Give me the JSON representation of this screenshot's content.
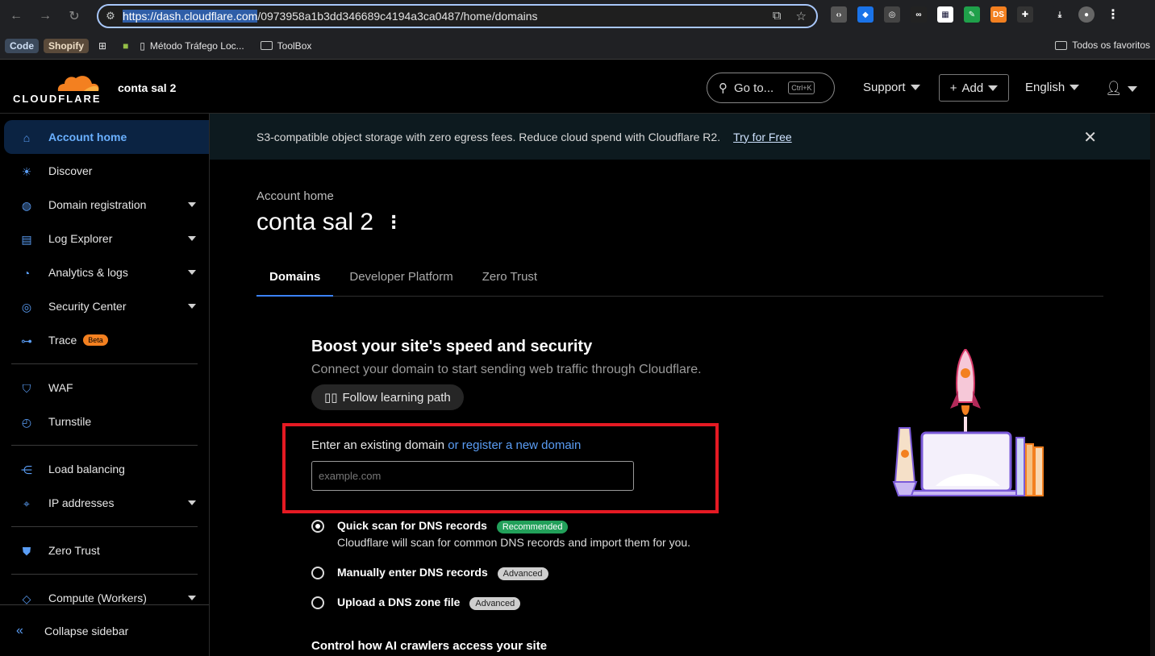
{
  "browser": {
    "url_selected": "https://dash.cloudflare.com",
    "url_rest": "/0973958a1b3dd346689c4194a3ca0487/home/domains",
    "bookmarks": {
      "code": "Code",
      "shopify": "Shopify",
      "metodo": "Método Tráfego Loc...",
      "toolbox": "ToolBox",
      "all": "Todos os favoritos"
    }
  },
  "header": {
    "logo_text": "CLOUDFLARE",
    "account": "conta sal 2",
    "goto": "Go to...",
    "goto_kbd": "Ctrl+K",
    "support": "Support",
    "add": "Add",
    "language": "English"
  },
  "sidebar": {
    "items": [
      {
        "label": "Account home",
        "icon": "home-icon"
      },
      {
        "label": "Discover",
        "icon": "lightbulb-icon"
      },
      {
        "label": "Domain registration",
        "icon": "globe-icon"
      },
      {
        "label": "Log Explorer",
        "icon": "document-icon"
      },
      {
        "label": "Analytics & logs",
        "icon": "pie-chart-icon"
      },
      {
        "label": "Security Center",
        "icon": "target-icon"
      },
      {
        "label": "Trace",
        "icon": "trace-icon",
        "badge": "Beta"
      },
      {
        "label": "WAF",
        "icon": "shield-icon"
      },
      {
        "label": "Turnstile",
        "icon": "turnstile-icon"
      },
      {
        "label": "Load balancing",
        "icon": "network-icon"
      },
      {
        "label": "IP addresses",
        "icon": "location-icon"
      },
      {
        "label": "Zero Trust",
        "icon": "zero-trust-icon"
      },
      {
        "label": "Compute (Workers)",
        "icon": "workers-icon"
      }
    ],
    "collapse": "Collapse sidebar"
  },
  "banner": {
    "text": "S3-compatible object storage with zero egress fees. Reduce cloud spend with Cloudflare R2.",
    "link": "Try for Free"
  },
  "page": {
    "breadcrumb": "Account home",
    "title": "conta sal 2",
    "tabs": [
      "Domains",
      "Developer Platform",
      "Zero Trust"
    ]
  },
  "onboarding": {
    "heading": "Boost your site's speed and security",
    "subheading": "Connect your domain to start sending web traffic through Cloudflare.",
    "learn_button": "Follow learning path",
    "domain_label": "Enter an existing domain",
    "register_link": "or register a new domain",
    "domain_placeholder": "example.com",
    "options": [
      {
        "title": "Quick scan for DNS records",
        "badge": "Recommended",
        "desc": "Cloudflare will scan for common DNS records and import them for you."
      },
      {
        "title": "Manually enter DNS records",
        "badge": "Advanced"
      },
      {
        "title": "Upload a DNS zone file",
        "badge": "Advanced"
      }
    ],
    "ai_heading": "Control how AI crawlers access your site"
  },
  "colors": {
    "accent": "#3b82f6",
    "brand_orange": "#f38020",
    "highlight_box": "#e51a23",
    "recommended": "#22a05a"
  }
}
